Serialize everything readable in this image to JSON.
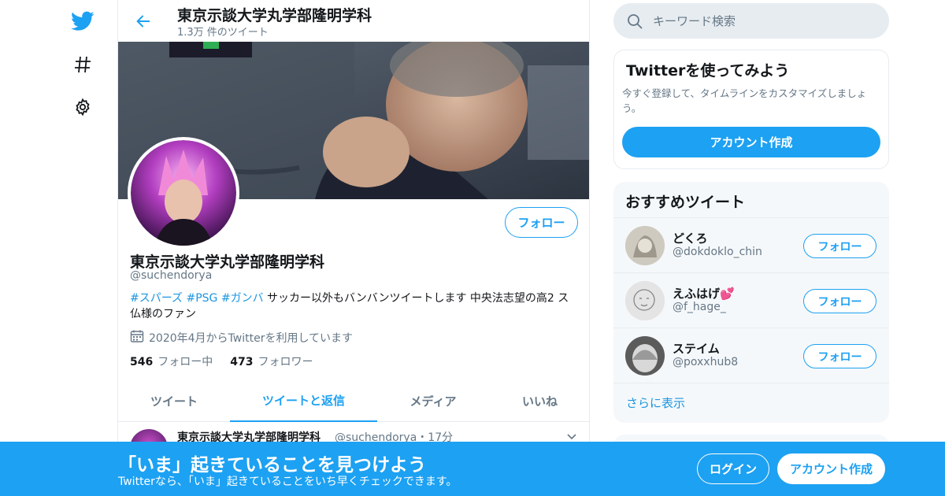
{
  "nav": {
    "icons": [
      "twitter-logo-icon",
      "hashtag-icon",
      "gear-icon"
    ]
  },
  "header": {
    "title": "東京示談大学丸学部隆明学科",
    "tweet_count": "1.3万 件のツイート"
  },
  "profile": {
    "name": "東京示談大学丸学部隆明学科",
    "handle": "@suchendorya",
    "follow_label": "フォロー",
    "bio_hashtags": [
      "#スパーズ",
      "#PSG",
      "#ガンバ"
    ],
    "bio_text": "サッカー以外もバンバンツイートします 中央法志望の高2 ス仏様のファン",
    "joined": "2020年4月からTwitterを利用しています",
    "following_count": "546",
    "following_label": "フォロー中",
    "followers_count": "473",
    "followers_label": "フォロワー"
  },
  "tabs": [
    "ツイート",
    "ツイートと返信",
    "メディア",
    "いいね"
  ],
  "active_tab": "ツイートと返信",
  "tweet": {
    "name": "東京示談大学丸学部隆明学科",
    "meta": "@suchendorya・17分"
  },
  "search": {
    "placeholder": "キーワード検索"
  },
  "signup_card": {
    "title": "Twitterを使ってみよう",
    "description": "今すぐ登録して、タイムラインをカスタマイズしましょう。",
    "button": "アカウント作成"
  },
  "recommend": {
    "title": "おすすめツイート",
    "items": [
      {
        "name": "どくろ",
        "handle": "@dokdoklo_chin",
        "follow": "フォロー"
      },
      {
        "name": "えふはげ💕",
        "handle": "@f_hage_",
        "follow": "フォロー"
      },
      {
        "name": "ステイム",
        "handle": "@poxxhub8",
        "follow": "フォロー"
      }
    ],
    "more": "さらに表示"
  },
  "bottom_bar": {
    "title": "「いま」起きていることを見つけよう",
    "subtitle": "Twitterなら、「いま」起きていることをいち早くチェックできます。",
    "login": "ログイン",
    "signup": "アカウント作成"
  },
  "colors": {
    "accent": "#1da1f2",
    "link": "#1b95e0",
    "secondary_text": "#657786",
    "border": "#e6ecf0"
  }
}
